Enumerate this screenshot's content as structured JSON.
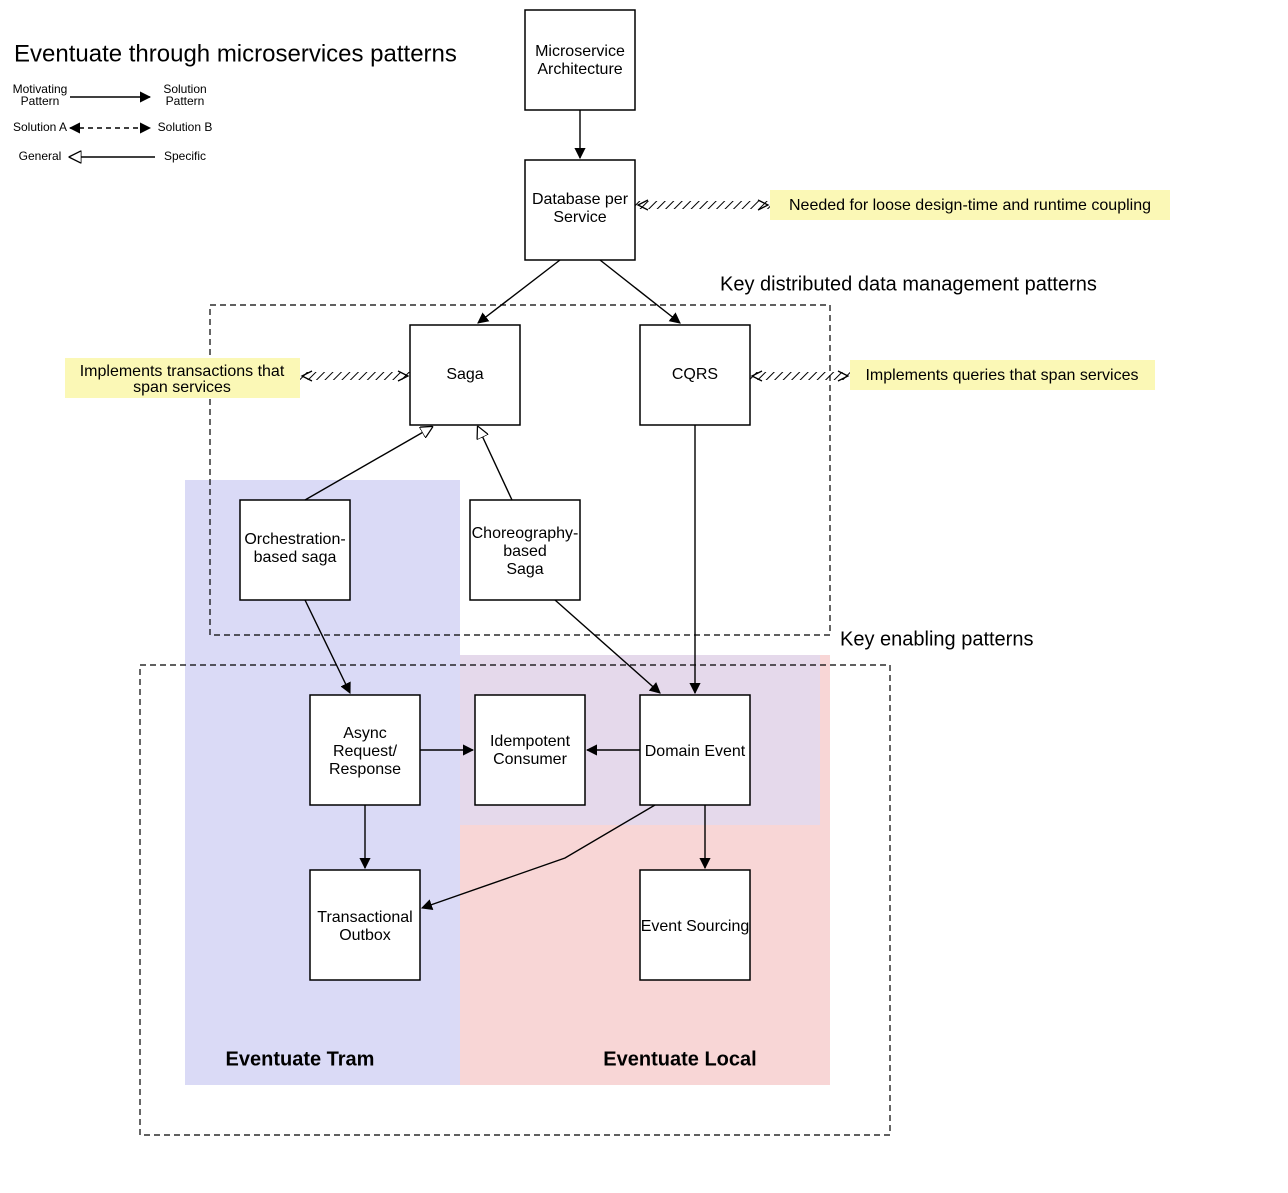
{
  "title": "Eventuate through microservices patterns",
  "legend": {
    "motivating": "Motivating\nPattern",
    "solution": "Solution\nPattern",
    "solutionA": "Solution A",
    "solutionB": "Solution B",
    "general": "General",
    "specific": "Specific"
  },
  "sections": {
    "ddm": "Key distributed data management patterns",
    "enabling": "Key enabling patterns"
  },
  "highlights": {
    "tram": "Eventuate Tram",
    "local": "Eventuate Local"
  },
  "nodes": {
    "microservice": "Microservice Architecture",
    "dbper": "Database per Service",
    "saga": "Saga",
    "cqrs": "CQRS",
    "orchSaga": "Orchestration-\nbased saga",
    "choreSaga": "Choreography-\nbased\nSaga",
    "asyncRR": "Async\nRequest/\nResponse",
    "idemp": "Idempotent\nConsumer",
    "domainEvent": "Domain Event",
    "txOutbox": "Transactional\nOutbox",
    "eventSourcing": "Event Sourcing"
  },
  "notes": {
    "loose": "Needed for loose design-time and runtime coupling",
    "sagaNote": "Implements transactions that span services",
    "cqrsNote": "Implements queries that span services"
  }
}
